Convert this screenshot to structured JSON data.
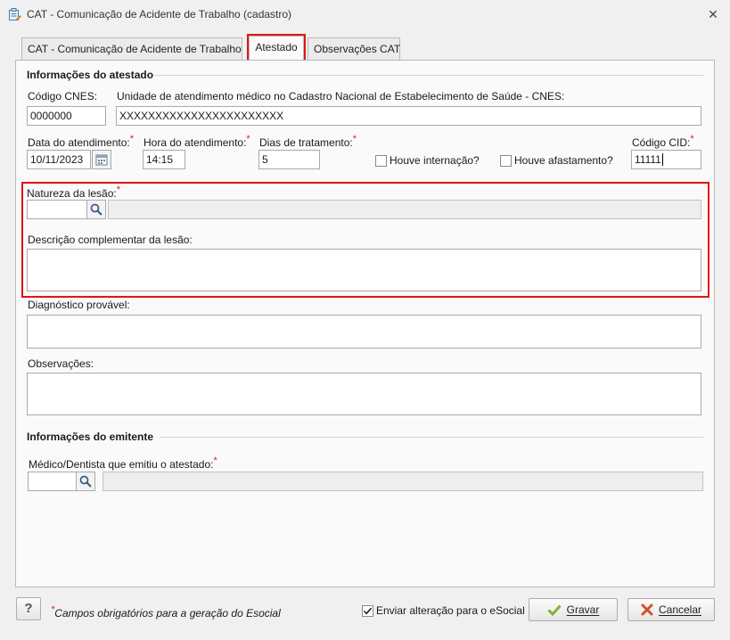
{
  "window": {
    "title": "CAT - Comunicação de Acidente de Trabalho (cadastro)",
    "close_icon": "close-icon"
  },
  "tabs": [
    {
      "label": "CAT - Comunicação de Acidente de Trabalho"
    },
    {
      "label": "Atestado"
    },
    {
      "label": "Observações CAT"
    }
  ],
  "atestado": {
    "section_title": "Informações do atestado",
    "cnes_label": "Código CNES:",
    "cnes_value": "0000000",
    "unidade_label": "Unidade de atendimento médico no Cadastro Nacional de Estabelecimento de Saúde - CNES:",
    "unidade_value": "XXXXXXXXXXXXXXXXXXXXXXX",
    "data_label": "Data do atendimento:",
    "data_value": "10/11/2023",
    "hora_label": "Hora do atendimento:",
    "hora_value": "14:15",
    "dias_label": "Dias de tratamento:",
    "dias_value": "5",
    "internacao_label": "Houve internação?",
    "afastamento_label": "Houve afastamento?",
    "cid_label": "Código CID:",
    "cid_value": "11111",
    "natureza_label": "Natureza da lesão:",
    "natureza_code": "",
    "natureza_desc": "",
    "descricao_label": "Descrição complementar da lesão:",
    "descricao_value": "",
    "diagnostico_label": "Diagnóstico provável:",
    "diagnostico_value": "",
    "observacoes_label": "Observações:",
    "observacoes_value": ""
  },
  "emitente": {
    "section_title": "Informações do emitente",
    "medico_label": "Médico/Dentista que emitiu o atestado:",
    "medico_code": "",
    "medico_desc": ""
  },
  "required_mark": "*",
  "footer": {
    "help_label": "?",
    "required_note": "Campos obrigatórios para a geração do Esocial",
    "enviar_label": "Enviar alteração para o eSocial",
    "enviar_checked": true,
    "save_label": "Gravar",
    "cancel_label": "Cancelar"
  }
}
